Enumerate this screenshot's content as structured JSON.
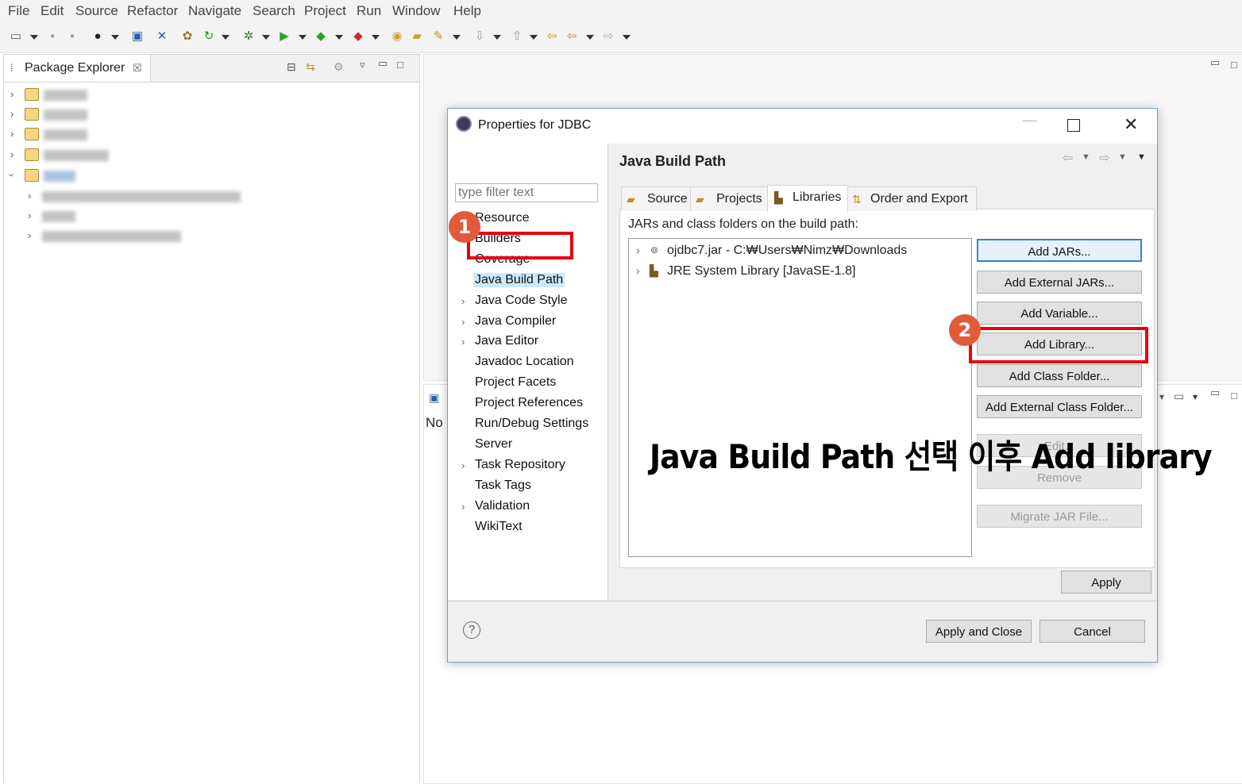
{
  "menubar": [
    "File",
    "Edit",
    "Source",
    "Refactor",
    "Navigate",
    "Search",
    "Project",
    "Run",
    "Window",
    "Help"
  ],
  "package_explorer": {
    "title": "Package Explorer",
    "close_glyph": "☒"
  },
  "bottom_view": {
    "stub_text": "No"
  },
  "dialog": {
    "title": "Properties for JDBC",
    "filter_placeholder": "type filter text",
    "nav": [
      {
        "label": "Resource",
        "expandable": true
      },
      {
        "label": "Builders",
        "expandable": false
      },
      {
        "label": "Coverage",
        "expandable": false
      },
      {
        "label": "Java Build Path",
        "expandable": false,
        "selected": true
      },
      {
        "label": "Java Code Style",
        "expandable": true
      },
      {
        "label": "Java Compiler",
        "expandable": true
      },
      {
        "label": "Java Editor",
        "expandable": true
      },
      {
        "label": "Javadoc Location",
        "expandable": false
      },
      {
        "label": "Project Facets",
        "expandable": false
      },
      {
        "label": "Project References",
        "expandable": false
      },
      {
        "label": "Run/Debug Settings",
        "expandable": false
      },
      {
        "label": "Server",
        "expandable": false
      },
      {
        "label": "Task Repository",
        "expandable": true
      },
      {
        "label": "Task Tags",
        "expandable": false
      },
      {
        "label": "Validation",
        "expandable": true
      },
      {
        "label": "WikiText",
        "expandable": false
      }
    ],
    "page_title": "Java Build Path",
    "tabs": [
      "Source",
      "Projects",
      "Libraries",
      "Order and Export"
    ],
    "active_tab": "Libraries",
    "section_label": "JARs and class folders on the build path:",
    "entries": [
      {
        "label": "ojdbc7.jar - C:₩Users₩Nimz₩Downloads",
        "icon": "jar-icon"
      },
      {
        "label": "JRE System Library [JavaSE-1.8]",
        "icon": "library-icon"
      }
    ],
    "buttons": {
      "add_jars": "Add JARs...",
      "add_external_jars": "Add External JARs...",
      "add_variable": "Add Variable...",
      "add_library": "Add Library...",
      "add_class_folder": "Add Class Folder...",
      "add_external_class_folder": "Add External Class Folder...",
      "edit": "Edit...",
      "remove": "Remove",
      "migrate": "Migrate JAR File...",
      "apply": "Apply",
      "apply_and_close": "Apply and Close",
      "cancel": "Cancel"
    }
  },
  "annotation": {
    "badge1": "1",
    "badge2": "2",
    "caption": "Java Build Path 선택 이후 Add library",
    "color": "#e60012"
  }
}
